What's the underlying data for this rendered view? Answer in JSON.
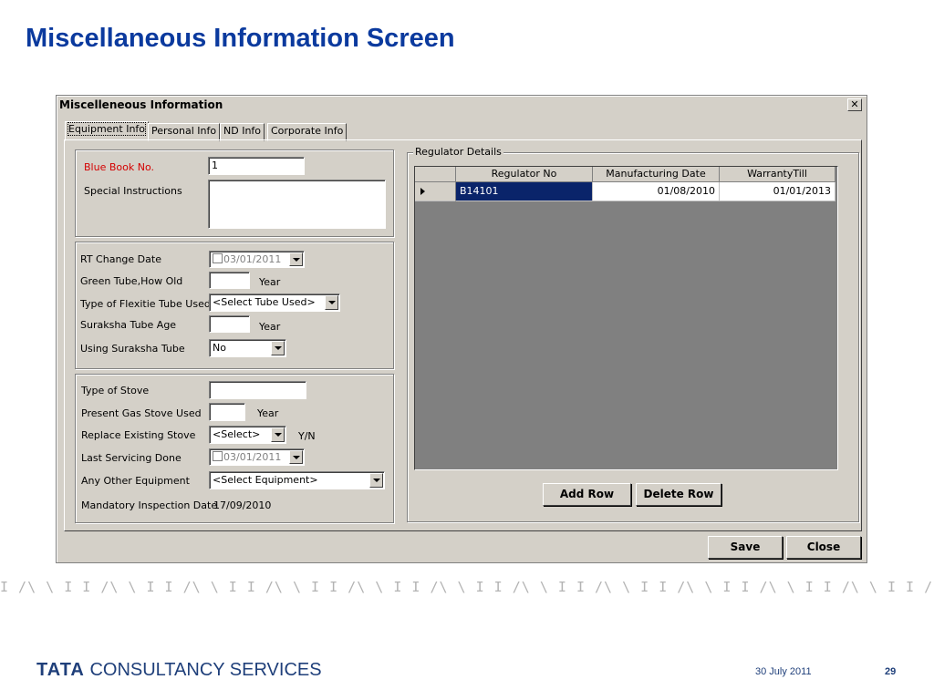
{
  "slide": {
    "title": "Miscellaneous Information Screen"
  },
  "window": {
    "title": "Miscelleneous Information",
    "close_glyph": "✕"
  },
  "tabs": [
    "Equipment Info",
    "Personal Info",
    "ND Info",
    "Corporate Info"
  ],
  "blue_book": {
    "label": "Blue Book No.",
    "value": "1"
  },
  "special_instructions": {
    "label": "Special Instructions",
    "value": ""
  },
  "rt_change_date": {
    "label": "RT Change Date",
    "value": "03/01/2011"
  },
  "green_tube": {
    "label": "Green Tube,How Old",
    "value": "",
    "unit": "Year"
  },
  "flexitie_tube": {
    "label": "Type of Flexitie Tube Used",
    "value": "<Select Tube Used>"
  },
  "suraksha_age": {
    "label": "Suraksha Tube Age",
    "value": "",
    "unit": "Year"
  },
  "using_suraksha": {
    "label": "Using Suraksha Tube",
    "value": "No"
  },
  "type_of_stove": {
    "label": "Type of Stove",
    "value": ""
  },
  "present_gas_stove": {
    "label": "Present Gas Stove Used",
    "value": "",
    "unit": "Year"
  },
  "replace_stove": {
    "label": "Replace Existing Stove",
    "value": "<Select>",
    "hint": "Y/N"
  },
  "last_servicing": {
    "label": "Last Servicing Done",
    "value": "03/01/2011"
  },
  "other_equipment": {
    "label": "Any Other Equipment",
    "value": "<Select Equipment>"
  },
  "mandatory_inspection": {
    "label": "Mandatory Inspection Date",
    "value": "17/09/2010"
  },
  "regulator": {
    "legend": "Regulator Details",
    "columns": [
      "Regulator No",
      "Manufacturing Date",
      "WarrantyTill"
    ],
    "rows": [
      {
        "regulator_no": "B14101",
        "manufacturing_date": "01/08/2010",
        "warranty_till": "01/01/2013"
      }
    ],
    "add_row": "Add Row",
    "delete_row": "Delete Row"
  },
  "buttons": {
    "save": "Save",
    "close": "Close"
  },
  "footer": {
    "stripe": "I /\\ \\ I I /\\ \\ I I /\\ \\ I I /\\ \\ I I /\\ \\ I I /\\ \\ I I /\\ \\ I I /\\ \\ I I /\\ \\ I I /\\ \\ I I /\\ \\ I I /\\ \\ I I /\\ \\ I I /\\ \\ I I /\\ \\ I I /\\ \\ I I /\\ \\ I I /\\ \\ I I /\\ \\ I I /\\ \\ I I /\\ \\ I I /\\",
    "logo_tata": "TATA",
    "logo_rest": "CONSULTANCY SERVICES",
    "date": "30 July 2011",
    "page": "29"
  },
  "colors": {
    "title_blue": "#0b3a9e",
    "selected_row": "#0a246a",
    "required_label": "#d40000"
  }
}
